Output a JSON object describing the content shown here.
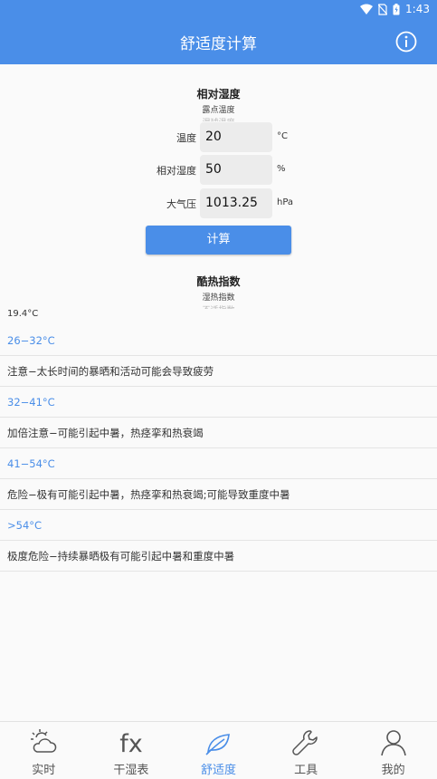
{
  "status": {
    "time": "1:43"
  },
  "appbar": {
    "title": "舒适度计算"
  },
  "top_picker": {
    "selected": "相对湿度",
    "next": "露点温度",
    "next2": "湿球温度"
  },
  "fields": [
    {
      "label": "温度",
      "value": "20",
      "unit": "°C"
    },
    {
      "label": "相对湿度",
      "value": "50",
      "unit": "%"
    },
    {
      "label": "大气压",
      "value": "1013.25",
      "unit": "hPa"
    }
  ],
  "calc_button": "计算",
  "index_picker": {
    "selected": "酷热指数",
    "next": "湿热指数",
    "next2": "不适指数"
  },
  "result": "19.4°C",
  "rows": [
    {
      "type": "range",
      "text": "26−32°C"
    },
    {
      "type": "desc",
      "text": "注意−太长时间的暴晒和活动可能会导致疲劳"
    },
    {
      "type": "range",
      "text": "32−41°C"
    },
    {
      "type": "desc",
      "text": "加倍注意−可能引起中暑，热痉挛和热衰竭"
    },
    {
      "type": "range",
      "text": "41−54°C"
    },
    {
      "type": "desc",
      "text": "危险−极有可能引起中暑，热痉挛和热衰竭;可能导致重度中暑"
    },
    {
      "type": "range",
      "text": ">54°C"
    },
    {
      "type": "desc",
      "text": "极度危险−持续暴晒极有可能引起中暑和重度中暑"
    }
  ],
  "nav": [
    {
      "label": "实时",
      "icon": "weather-icon"
    },
    {
      "label": "干湿表",
      "icon": "fx-icon"
    },
    {
      "label": "舒适度",
      "icon": "leaf-icon",
      "active": true
    },
    {
      "label": "工具",
      "icon": "wrench-icon"
    },
    {
      "label": "我的",
      "icon": "person-icon"
    }
  ],
  "colors": {
    "primary": "#4a8ee8"
  }
}
